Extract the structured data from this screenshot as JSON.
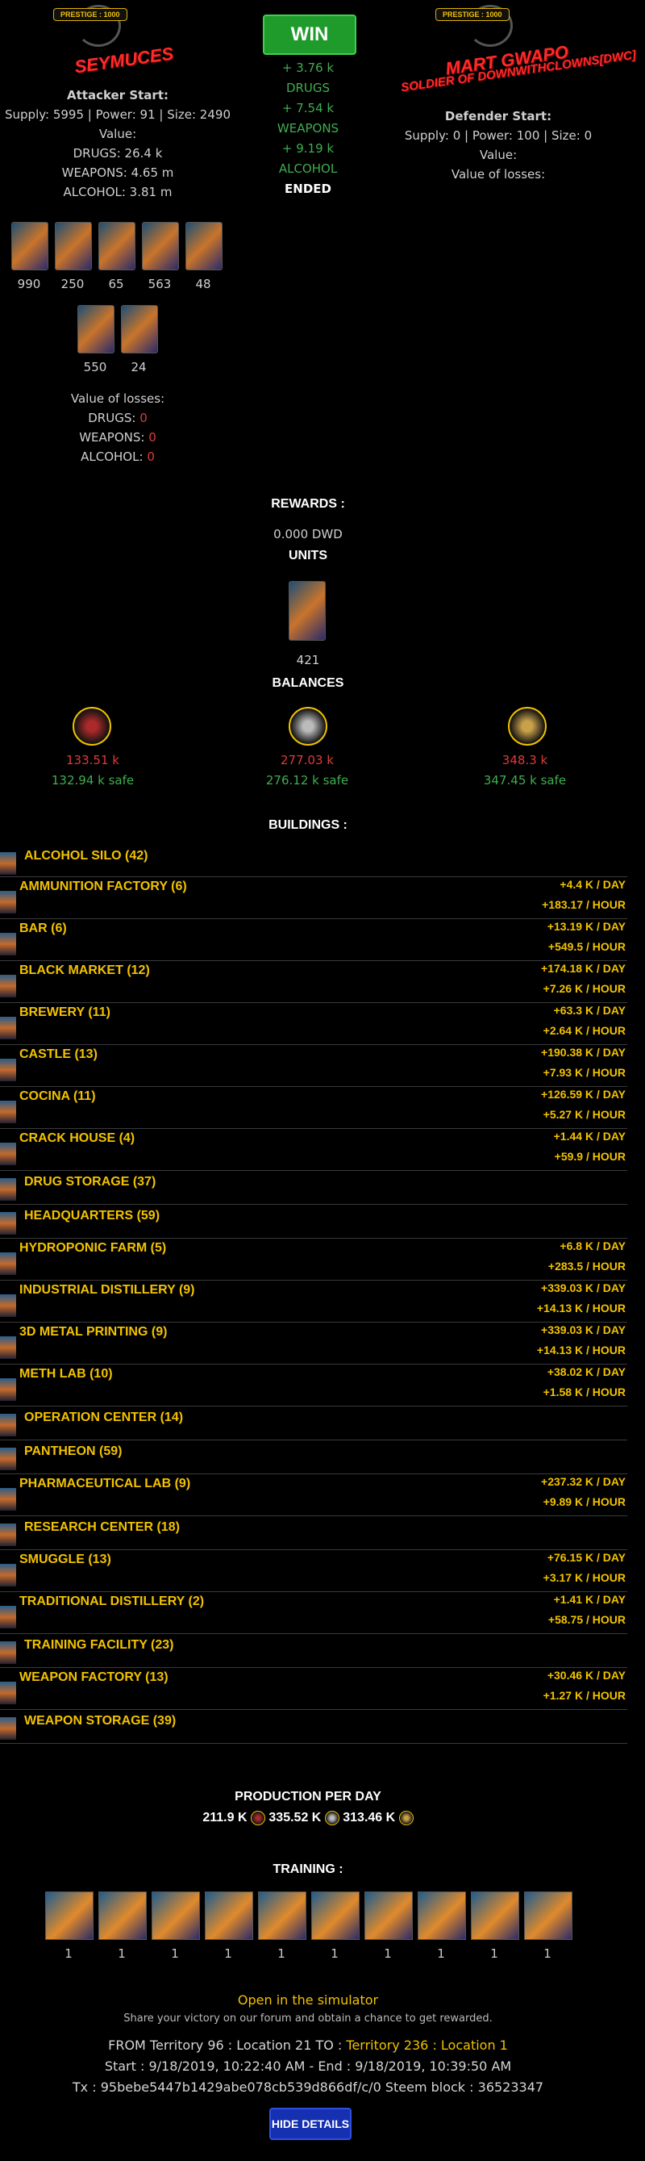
{
  "attacker": {
    "prestige": "PRESTIGE : 1000",
    "name": "SEYMUCES",
    "start_label": "Attacker Start:",
    "stats": "Supply: 5995 | Power: 91 | Size: 2490",
    "value_label": "Value:",
    "drugs": "DRUGS: 26.4 k",
    "weapons": "WEAPONS: 4.65 m",
    "alcohol": "ALCOHOL: 3.81 m",
    "units": [
      "990",
      "250",
      "65",
      "563",
      "48",
      "550",
      "24"
    ],
    "losses_label": "Value of losses:",
    "loss_drugs_label": "DRUGS:",
    "loss_drugs": "0",
    "loss_weapons_label": "WEAPONS:",
    "loss_weapons": "0",
    "loss_alcohol_label": "ALCOHOL:",
    "loss_alcohol": "0"
  },
  "result": {
    "win": "WIN",
    "gain_drugs": "+ 3.76 k",
    "drugs_label": "DRUGS",
    "gain_weapons": "+ 7.54 k",
    "weapons_label": "WEAPONS",
    "gain_alcohol": "+ 9.19 k",
    "alcohol_label": "ALCOHOL",
    "status": "ENDED"
  },
  "defender": {
    "prestige": "PRESTIGE : 1000",
    "name": "MART GWAPO",
    "subtitle": "SOLDIER OF DOWNWITHCLOWNS[DWC]",
    "start_label": "Defender Start:",
    "stats": "Supply: 0 | Power: 100 | Size: 0",
    "value_label": "Value:",
    "losses_label": "Value of losses:"
  },
  "rewards": {
    "title": "REWARDS :",
    "dwd": "0.000 DWD",
    "units_title": "UNITS",
    "unit_count": "421",
    "balances_title": "BALANCES",
    "balances": [
      {
        "icon": "drugs-icon",
        "value": "133.51 k",
        "safe": "132.94 k safe"
      },
      {
        "icon": "weapons-icon",
        "value": "277.03 k",
        "safe": "276.12 k safe"
      },
      {
        "icon": "alcohol-icon",
        "value": "348.3 k",
        "safe": "347.45 k safe"
      }
    ]
  },
  "buildings_title": "BUILDINGS :",
  "buildings": [
    {
      "name": "ALCOHOL SILO (42)",
      "day": "",
      "hour": ""
    },
    {
      "name": "AMMUNITION FACTORY (6)",
      "day": "+4.4 K / DAY",
      "hour": "+183.17 / HOUR"
    },
    {
      "name": "BAR (6)",
      "day": "+13.19 K / DAY",
      "hour": "+549.5 / HOUR"
    },
    {
      "name": "BLACK MARKET (12)",
      "day": "+174.18 K / DAY",
      "hour": "+7.26 K / HOUR"
    },
    {
      "name": "BREWERY (11)",
      "day": "+63.3 K / DAY",
      "hour": "+2.64 K / HOUR"
    },
    {
      "name": "CASTLE (13)",
      "day": "+190.38 K / DAY",
      "hour": "+7.93 K / HOUR"
    },
    {
      "name": "COCINA (11)",
      "day": "+126.59 K / DAY",
      "hour": "+5.27 K / HOUR"
    },
    {
      "name": "CRACK HOUSE (4)",
      "day": "+1.44 K / DAY",
      "hour": "+59.9 / HOUR"
    },
    {
      "name": "DRUG STORAGE (37)",
      "day": "",
      "hour": ""
    },
    {
      "name": "HEADQUARTERS (59)",
      "day": "",
      "hour": ""
    },
    {
      "name": "HYDROPONIC FARM (5)",
      "day": "+6.8 K / DAY",
      "hour": "+283.5 / HOUR"
    },
    {
      "name": "INDUSTRIAL DISTILLERY (9)",
      "day": "+339.03 K / DAY",
      "hour": "+14.13 K / HOUR"
    },
    {
      "name": "3D METAL PRINTING (9)",
      "day": "+339.03 K / DAY",
      "hour": "+14.13 K / HOUR"
    },
    {
      "name": "METH LAB (10)",
      "day": "+38.02 K / DAY",
      "hour": "+1.58 K / HOUR"
    },
    {
      "name": "OPERATION CENTER (14)",
      "day": "",
      "hour": ""
    },
    {
      "name": "PANTHEON (59)",
      "day": "",
      "hour": ""
    },
    {
      "name": "PHARMACEUTICAL LAB (9)",
      "day": "+237.32 K / DAY",
      "hour": "+9.89 K / HOUR"
    },
    {
      "name": "RESEARCH CENTER (18)",
      "day": "",
      "hour": ""
    },
    {
      "name": "SMUGGLE (13)",
      "day": "+76.15 K / DAY",
      "hour": "+3.17 K / HOUR"
    },
    {
      "name": "TRADITIONAL DISTILLERY (2)",
      "day": "+1.41 K / DAY",
      "hour": "+58.75 / HOUR"
    },
    {
      "name": "TRAINING FACILITY (23)",
      "day": "",
      "hour": ""
    },
    {
      "name": "WEAPON FACTORY (13)",
      "day": "+30.46 K / DAY",
      "hour": "+1.27 K / HOUR"
    },
    {
      "name": "WEAPON STORAGE (39)",
      "day": "",
      "hour": ""
    }
  ],
  "production": {
    "title": "PRODUCTION PER DAY",
    "drugs": "211.9 K",
    "weapons": "335.52 K",
    "alcohol": "313.46 K"
  },
  "training": {
    "title": "TRAINING :",
    "counts": [
      "1",
      "1",
      "1",
      "1",
      "1",
      "1",
      "1",
      "1",
      "1",
      "1"
    ]
  },
  "footer": {
    "simulator": "Open in the simulator",
    "share": "Share your victory on our forum and obtain a chance to get rewarded.",
    "from": "FROM Territory 96 : Location 21 TO :",
    "to": "Territory 236 : Location 1",
    "times": "Start : 9/18/2019, 10:22:40 AM - End : 9/18/2019, 10:39:50 AM",
    "tx": "Tx : 95bebe5447b1429abe078cb539d866df/c/0 Steem block : 36523347",
    "hide_button": "HIDE DETAILS"
  },
  "colors": {
    "gold": "#f2c200",
    "red": "#e03a3a",
    "green": "#3fae4f",
    "blue_button": "#1530b0"
  }
}
